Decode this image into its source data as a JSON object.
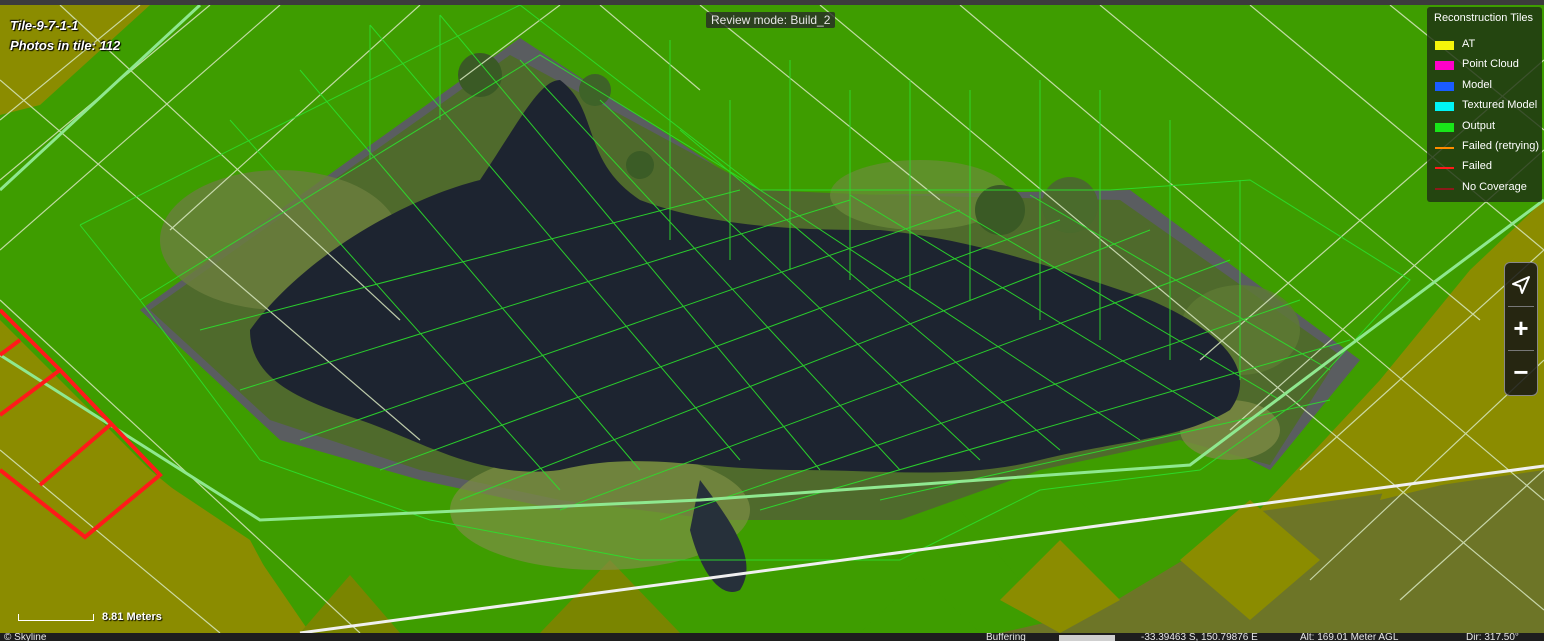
{
  "tile": {
    "name": "Tile-9-7-1-1",
    "photos": "Photos in tile: 112"
  },
  "review_mode": "Review mode: Build_2",
  "legend": {
    "title": "Reconstruction Tiles",
    "items": [
      {
        "label": "AT",
        "color": "#f5f50a",
        "kind": "box"
      },
      {
        "label": "Point Cloud",
        "color": "#ff00c8",
        "kind": "box"
      },
      {
        "label": "Model",
        "color": "#1a5cff",
        "kind": "box"
      },
      {
        "label": "Textured Model",
        "color": "#00f5f5",
        "kind": "box"
      },
      {
        "label": "Output",
        "color": "#19e619",
        "kind": "box"
      },
      {
        "label": "Failed (retrying)",
        "color": "#ff8c00",
        "kind": "line"
      },
      {
        "label": "Failed",
        "color": "#ff1a1a",
        "kind": "line"
      },
      {
        "label": "No Coverage",
        "color": "#8b1a1a",
        "kind": "line"
      }
    ]
  },
  "nav": {
    "north_icon": "navigation-arrow-icon",
    "zoom_in": "+",
    "zoom_out": "−"
  },
  "scale": {
    "label": "8.81 Meters"
  },
  "status": {
    "brand": "© Skyline",
    "buffering": "Buffering",
    "coords": "-33.39463 S, 150.79876 E",
    "altitude": "Alt: 169.01 Meter AGL",
    "direction": "Dir: 317.50°"
  },
  "colors": {
    "green_tile": "#3e9d00",
    "olive_tile": "#8b8c00",
    "grid_line": "#d8e8c0",
    "frame": "#2ce02c",
    "water": "#1d2430"
  }
}
